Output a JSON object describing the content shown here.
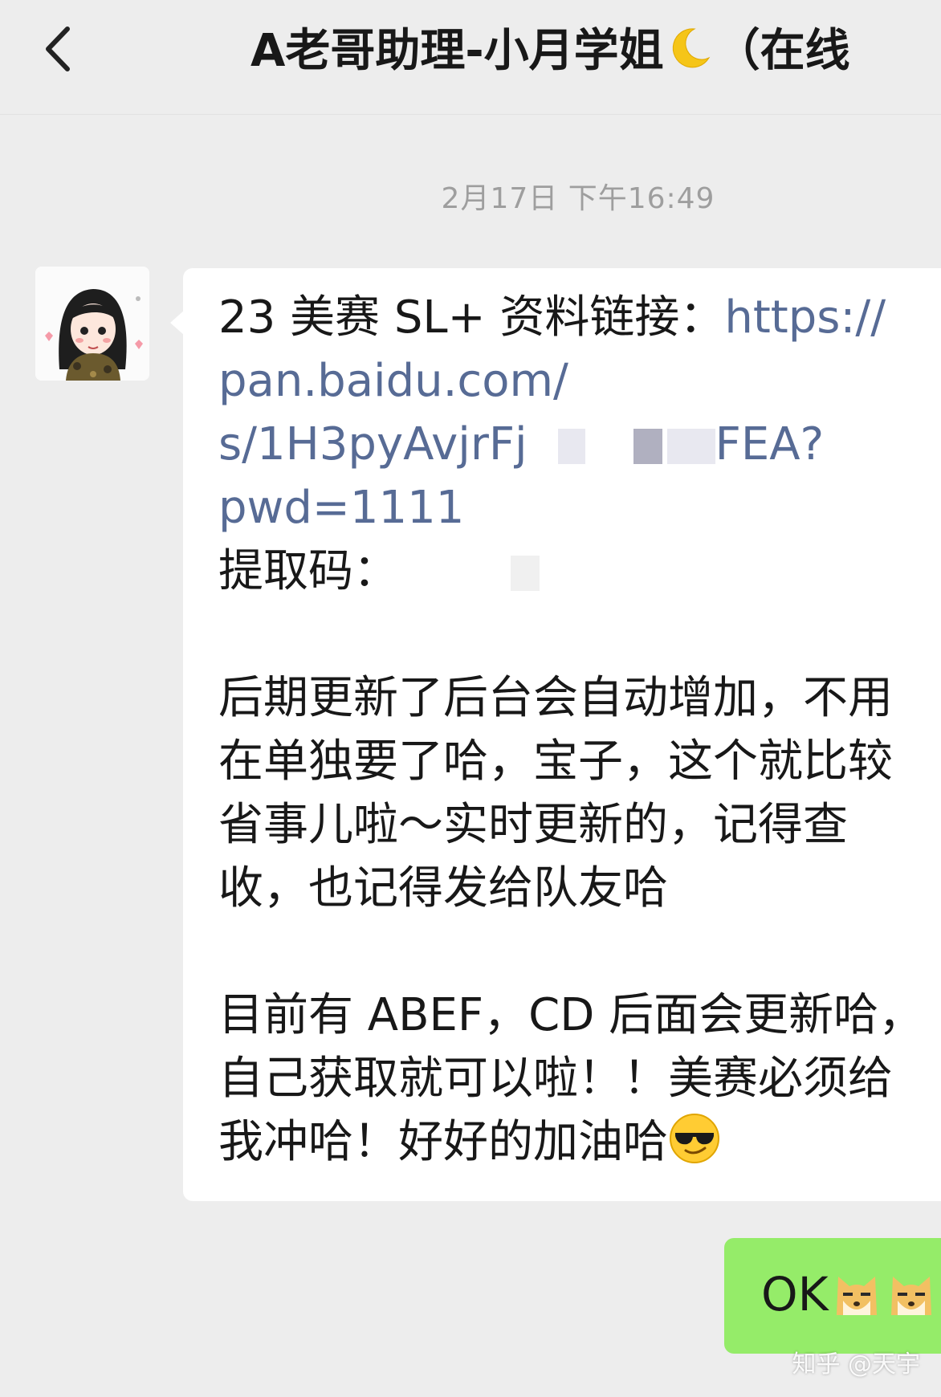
{
  "header": {
    "title": "A老哥助理-小月学姐",
    "title_suffix": "（在线",
    "back_icon": "chevron-left-icon",
    "moon_icon": "crescent-moon-icon"
  },
  "timestamp": "2月17日 下午16:49",
  "incoming": {
    "line1_text": "23 美赛 SL+ 资料链接：",
    "line1_link": "https://",
    "link_line2": "pan.baidu.com/",
    "link_line3_a": "s/1H3pyAvjrFj",
    "link_line3_b": "FEA?",
    "link_line4": "pwd=1111",
    "code_label": "提取码：",
    "para2": [
      "后期更新了后台会自动增加，不用",
      "在单独要了哈，宝子，这个就比较",
      "省事儿啦～实时更新的，记得查",
      "收，也记得发给队友哈"
    ],
    "para3": [
      "目前有 ABEF，CD 后面会更新哈，",
      "自己获取就可以啦！！美赛必须给",
      "我冲哈！好好的加油哈"
    ],
    "emoji": "sunglasses-face-icon"
  },
  "outgoing": {
    "text": "OK",
    "emoji": "doge-icon"
  },
  "watermark": "知乎 @天宇",
  "colors": {
    "background": "#ededed",
    "incoming_bubble": "#ffffff",
    "outgoing_bubble": "#95ec69",
    "link": "#576b95",
    "timestamp": "#9e9e9e"
  }
}
